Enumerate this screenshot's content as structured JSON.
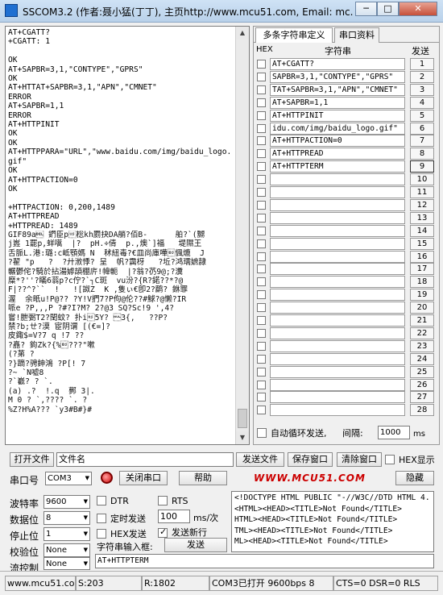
{
  "window": {
    "title": "SSCOM3.2 (作者:聂小猛(丁丁), 主页http://www.mcu51.com,  Email: mc...",
    "min_label": "─",
    "max_label": "□",
    "close_label": "✕"
  },
  "receive": {
    "text_top": "AT+CGATT?\n+CGATT: 1\n\nOK\nAT+SAPBR=3,1,\"CONTYPE\",\"GPRS\"\nOK\nAT+HTTAT+SAPBR=3,1,\"APN\",\"CMNET\"\nERROR\nAT+SAPBR=1,1\nERROR\nAT+HTTPINIT\nOK\nOK\nAT+HTTPPARA=\"URL\",\"www.baidu.com/img/baidu_logo.gif\"\nOK\nAT+HTTPACTION=0\nOK\n\n+HTTPACTION: 0,200,1489\nAT+HTTPREAD\n+HTTPREAD: 1489",
    "binary": "GIF89a\u0007 鍆臣p\u001f棇kh罽抉DA艄?佰B-      舶?`(嬲\nj嶳 1罷p,蛘嚆  |?  pH.÷倩  p.,燠`]福   堤隰王\n舌脈L.港:璐:c岻顎媽 N  秫紐毒?€皿尚庫嘩\b偑熝  J\n?翟 \"p   ?  ?廾浟悸? 呈  帆?靄枒   ?坵?鸿瓀嫬隷\n輾鬱侘?騎於拈湯嫭頡棚庍!幃軛  |?翁?芿9@;?瀵\n糜*?''?瞞6蓊p?c佇?`┐C斑  vu汾?{R?鍩??*?@\nF|??^?``  !   ![詉Z  K ,隻ぃ€卽2?鹛? 銝罪\n渥  余眂u!P@?? ?Y!V捫7?P佝@伦??#鯄?@懒?IR\n哌e ?P,,,P ?#?I?M? 2?@3 SQ?Sc!9 ',4?\n嘗!朑弻T2?閏蚊? 扑i\u001e5Y? \u00003{,   ??P?\n禁?b;ㄝ?漠 宦阴谓 [(€=]?\n皮鋷$=V?7 q !7 ??\n?嚞? 鉤Zk?{%\b???\"嗽\n(?苐 ?\n?}蹢?骋鉮鴻 ?P[! 7\n?~ `N嘘8\n?`嶻? ? `.\n(a) .?  !.q  鄸 3|.\nM 0 ? `,???? `. ?\n%Z?H%A??? `y3#B#}#"
  },
  "tabs": {
    "multi": "多条字符串定义",
    "port": "串口资料"
  },
  "grid": {
    "hex_header": "HEX",
    "string_header": "字符串",
    "send_header": "发送",
    "rows": [
      {
        "text": "AT+CGATT?",
        "num": "1"
      },
      {
        "text": "SAPBR=3,1,\"CONTYPE\",\"GPRS\"",
        "num": "2"
      },
      {
        "text": "TAT+SAPBR=3,1,\"APN\",\"CMNET\"",
        "num": "3"
      },
      {
        "text": "AT+SAPBR=1,1",
        "num": "4"
      },
      {
        "text": "AT+HTTPINIT",
        "num": "5"
      },
      {
        "text": "idu.com/img/baidu_logo.gif\"",
        "num": "6"
      },
      {
        "text": "AT+HTTPACTION=0",
        "num": "7"
      },
      {
        "text": "AT+HTTPREAD",
        "num": "8"
      },
      {
        "text": "AT+HTTPTERM",
        "num": "9"
      },
      {
        "text": "",
        "num": "10"
      },
      {
        "text": "",
        "num": "11"
      },
      {
        "text": "",
        "num": "12"
      },
      {
        "text": "",
        "num": "13"
      },
      {
        "text": "",
        "num": "14"
      },
      {
        "text": "",
        "num": "15"
      },
      {
        "text": "",
        "num": "16"
      },
      {
        "text": "",
        "num": "17"
      },
      {
        "text": "",
        "num": "18"
      },
      {
        "text": "",
        "num": "19"
      },
      {
        "text": "",
        "num": "20"
      },
      {
        "text": "",
        "num": "21"
      },
      {
        "text": "",
        "num": "22"
      },
      {
        "text": "",
        "num": "23"
      },
      {
        "text": "",
        "num": "24"
      },
      {
        "text": "",
        "num": "25"
      },
      {
        "text": "",
        "num": "26"
      },
      {
        "text": "",
        "num": "27"
      },
      {
        "text": "",
        "num": "28"
      }
    ],
    "loop_label": "自动循环发送,",
    "interval_label": "间隔:",
    "interval_value": "1000",
    "interval_unit": "ms"
  },
  "file_row": {
    "open_file": "打开文件",
    "file_name": "文件名",
    "send_file": "发送文件",
    "save_window": "保存窗口",
    "clear_window": "清除窗口",
    "hex_display": "HEX显示"
  },
  "port_row": {
    "port_label": "串口号",
    "port_value": "COM3",
    "close_port": "关闭串口",
    "help": "帮助",
    "site": "WWW.MCU51.COM",
    "hide": "隐藏"
  },
  "settings": {
    "baud_label": "波特率",
    "baud_value": "9600",
    "data_label": "数据位",
    "data_value": "8",
    "stop_label": "停止位",
    "stop_value": "1",
    "parity_label": "校验位",
    "parity_value": "None",
    "flow_label": "流控制",
    "flow_value": "None",
    "dtr": "DTR",
    "rts": "RTS",
    "timed_send": "定时发送",
    "period_value": "100",
    "period_unit": "ms/次",
    "hex_send": "HEX发送",
    "send_newline": "发送新行",
    "input_label": "字符串输入框:",
    "send_button": "发送",
    "input_value": "AT+HTTPTERM"
  },
  "hexpane": {
    "text": "<!DOCTYPE HTML PUBLIC \"-//W3C//DTD HTML 4.\n<HTML><HEAD><TITLE>Not Found</TITLE>\nHTML><HEAD><TITLE>Not Found</TITLE>\nTML><HEAD><TITLE>Not Found</TITLE>\nML><HEAD><TITLE>Not Found</TITLE>"
  },
  "status": {
    "site": "www.mcu51.cor",
    "s": "S:203",
    "r": "R:1802",
    "port_state": "COM3已打开  9600bps  8",
    "lines": "CTS=0 DSR=0 RLS"
  },
  "colors": {
    "site_link": "#cc0000",
    "led": "#d10c0c"
  }
}
